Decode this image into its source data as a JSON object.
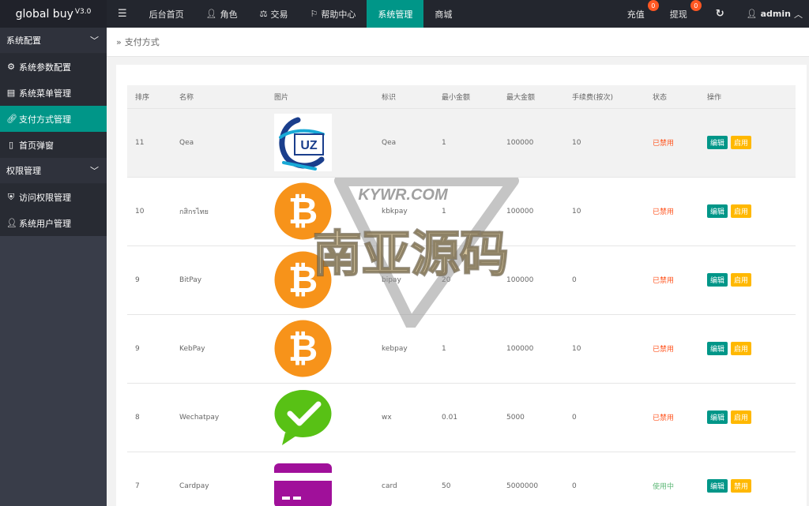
{
  "app": {
    "logo": "global buy",
    "version": "V3.0"
  },
  "nav": {
    "menu_toggle": "☰",
    "items": [
      "后台首页",
      "角色",
      "交易",
      "帮助中心",
      "系统管理",
      "商城"
    ],
    "active_index": 4
  },
  "header_right": {
    "recharge": "充值",
    "recharge_badge": "0",
    "withdraw": "提现",
    "withdraw_badge": "0",
    "refresh": "↻",
    "user": "admin"
  },
  "sidebar": {
    "groups": [
      {
        "title": "系统配置",
        "items": [
          "系统参数配置",
          "系统菜单管理",
          "支付方式管理",
          "首页弹窗"
        ]
      },
      {
        "title": "权限管理",
        "items": [
          "访问权限管理",
          "系统用户管理"
        ]
      }
    ],
    "active_item": "支付方式管理"
  },
  "breadcrumb": {
    "sep": "»",
    "title": "支付方式"
  },
  "table": {
    "headers": [
      "排序",
      "名称",
      "图片",
      "标识",
      "最小金额",
      "最大金额",
      "手续费(按次)",
      "状态",
      "操作"
    ],
    "rows": [
      {
        "sort": "11",
        "name": "Qea",
        "icon": "uz-logo-icon",
        "code": "Qea",
        "min": "1",
        "max": "100000",
        "fee": "10",
        "status": "已禁用",
        "status_type": "off",
        "edit": "编辑",
        "toggle": "启用"
      },
      {
        "sort": "10",
        "name": "กสิกรไทย",
        "icon": "bitcoin-icon",
        "code": "kbkpay",
        "min": "1",
        "max": "100000",
        "fee": "10",
        "status": "已禁用",
        "status_type": "off",
        "edit": "编辑",
        "toggle": "启用"
      },
      {
        "sort": "9",
        "name": "BitPay",
        "icon": "bitcoin-icon",
        "code": "bipay",
        "min": "20",
        "max": "100000",
        "fee": "0",
        "status": "已禁用",
        "status_type": "off",
        "edit": "编辑",
        "toggle": "启用"
      },
      {
        "sort": "9",
        "name": "KebPay",
        "icon": "bitcoin-icon",
        "code": "kebpay",
        "min": "1",
        "max": "100000",
        "fee": "10",
        "status": "已禁用",
        "status_type": "off",
        "edit": "编辑",
        "toggle": "启用"
      },
      {
        "sort": "8",
        "name": "Wechatpay",
        "icon": "wechat-check-icon",
        "code": "wx",
        "min": "0.01",
        "max": "5000",
        "fee": "0",
        "status": "已禁用",
        "status_type": "off",
        "edit": "编辑",
        "toggle": "启用"
      },
      {
        "sort": "7",
        "name": "Cardpay",
        "icon": "card-icon",
        "code": "card",
        "min": "50",
        "max": "5000000",
        "fee": "0",
        "status": "使用中",
        "status_type": "on",
        "edit": "编辑",
        "toggle": "禁用"
      }
    ]
  },
  "watermark": {
    "top": "KYWR.COM",
    "main": "南亚源码"
  },
  "colors": {
    "accent": "#009688",
    "topbar": "#23262e",
    "sidebar": "#393d49",
    "danger": "#ff5722",
    "warn": "#ffb800",
    "success": "#5fb878"
  }
}
